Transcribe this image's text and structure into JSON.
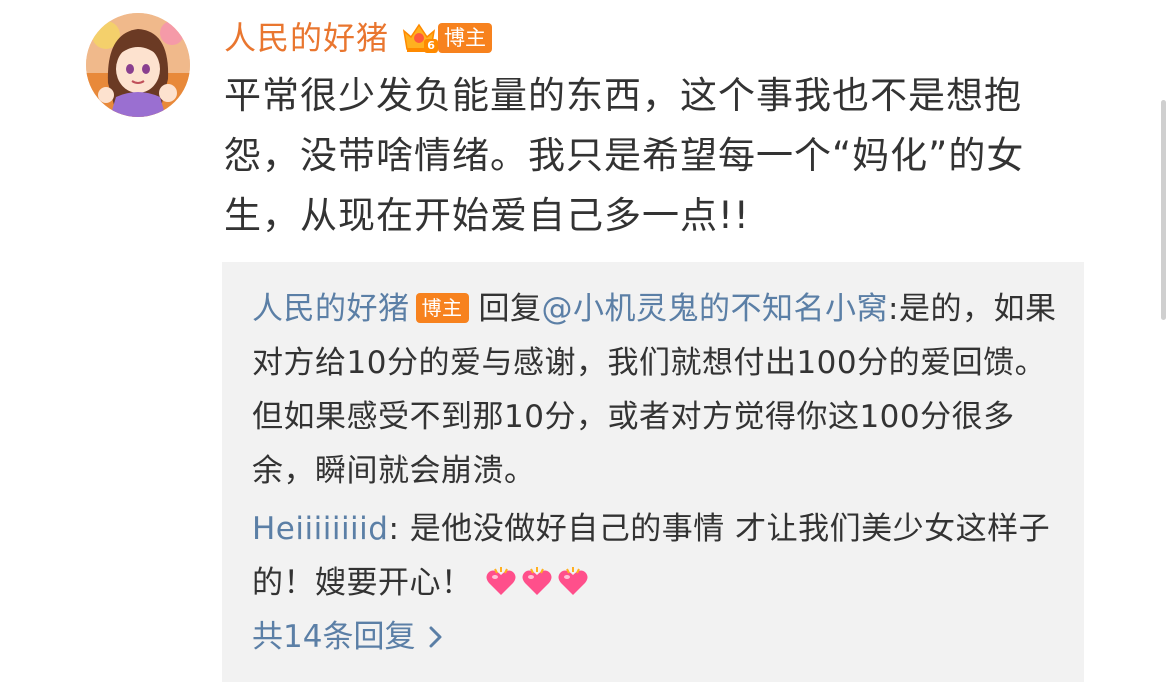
{
  "post": {
    "author": "人民的好猪",
    "vip_level": "6",
    "author_tag": "博主",
    "text": "平常很少发负能量的东西，这个事我也不是想抱怨，没带啥情绪。我只是希望每一个“妈化”的女生，从现在开始爱自己多一点!!"
  },
  "replies": [
    {
      "user": "人民的好猪",
      "tag": "博主",
      "reply_word": "回复",
      "mention": "@小机灵鬼的不知名小窝",
      "text": ":是的，如果对方给10分的爱与感谢，我们就想付出100分的爱回馈。但如果感受不到那10分，或者对方觉得你这100分很多余，瞬间就会崩溃。"
    },
    {
      "user": "Heiiiiiiiid",
      "text": ": 是他没做好自己的事情 才让我们美少女这样子的！嫂要开心！",
      "emoji": "heart-emoji"
    }
  ],
  "more_replies": "共14条回复",
  "colors": {
    "author": "#e9762f",
    "link": "#5b7fa6",
    "tag_bg": "#f7821e",
    "reply_bg": "#f2f2f2"
  }
}
